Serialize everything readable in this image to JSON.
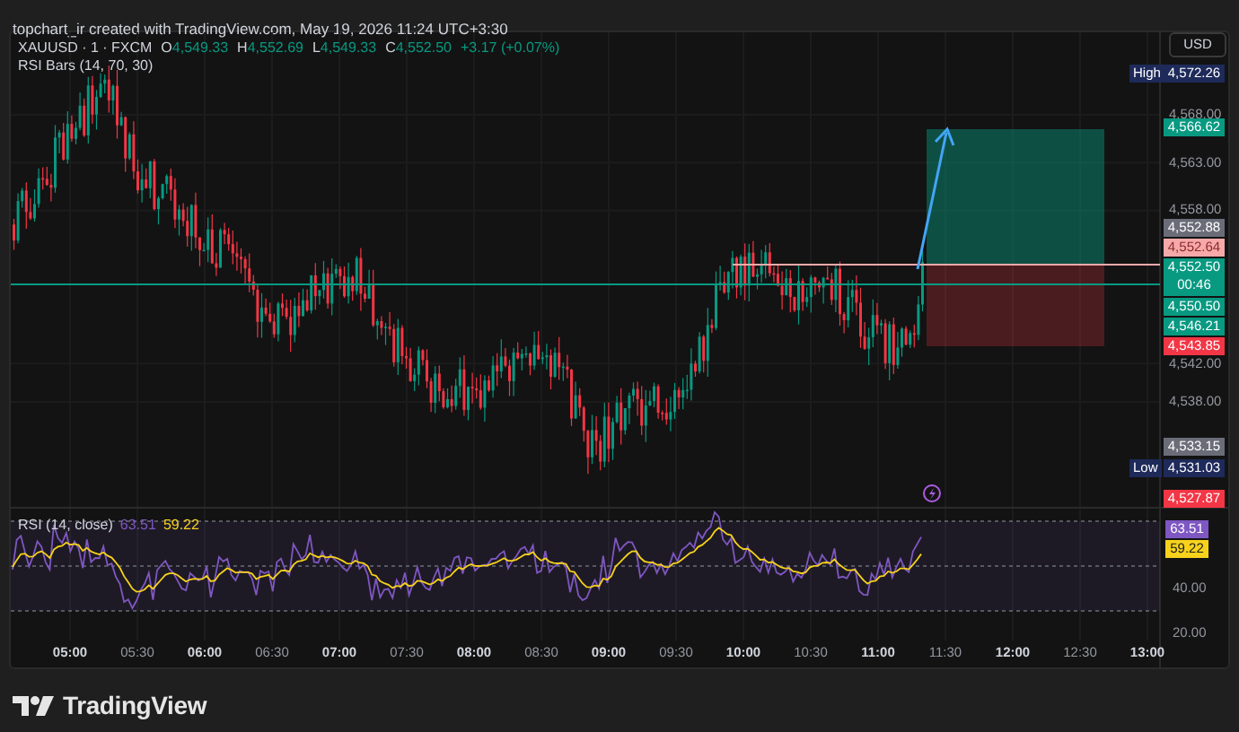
{
  "header": {
    "caption": "topchart_ir created with TradingView.com, May 19, 2026 11:24 UTC+3:30"
  },
  "legend": {
    "symbol": "XAUUSD · 1 · FXCM",
    "values": [
      {
        "label": "O",
        "value": "4,549.33"
      },
      {
        "label": "H",
        "value": "4,552.69"
      },
      {
        "label": "L",
        "value": "4,549.33"
      },
      {
        "label": "C",
        "value": "4,552.50"
      }
    ],
    "change": "+3.17 (+0.07%)",
    "indicator": "RSI Bars (14, 70, 30)"
  },
  "price_axis": {
    "currency": "USD",
    "ticks": [
      "4,568.00",
      "4,563.00",
      "4,558.00",
      "4,542.00",
      "4,538.00"
    ],
    "labels": [
      {
        "kind": "marker",
        "tag": "High",
        "text": "4,572.26"
      },
      {
        "kind": "price",
        "text": "4,566.62",
        "color": "#089981"
      },
      {
        "kind": "price",
        "text": "4,552.88",
        "color": "#6a6d78"
      },
      {
        "kind": "price",
        "text": "4,552.64",
        "color": "#f7a9a9"
      },
      {
        "kind": "countdown",
        "text": "4,552.50",
        "sub": "00:46",
        "color": "#089981"
      },
      {
        "kind": "price",
        "text": "4,550.50",
        "color": "#089981"
      },
      {
        "kind": "price",
        "text": "4,546.21",
        "color": "#089981"
      },
      {
        "kind": "price",
        "text": "4,543.85",
        "color": "#f23645"
      },
      {
        "kind": "price",
        "text": "4,533.15",
        "color": "#6a6d78"
      },
      {
        "kind": "marker",
        "tag": "Low",
        "text": "4,531.03"
      },
      {
        "kind": "price",
        "text": "4,527.87",
        "color": "#f23645"
      }
    ]
  },
  "rsi": {
    "title": "RSI (14, close)",
    "value": "63.51",
    "average": "59.22",
    "ticks": [
      "40.00",
      "20.00"
    ],
    "labels": [
      {
        "text": "63.51",
        "color": "#7e57c2"
      },
      {
        "text": "59.22",
        "color": "#f7d21c"
      }
    ]
  },
  "time_axis": [
    {
      "label": "05:00",
      "major": true
    },
    {
      "label": "05:30",
      "major": false
    },
    {
      "label": "06:00",
      "major": true
    },
    {
      "label": "06:30",
      "major": false
    },
    {
      "label": "07:00",
      "major": true
    },
    {
      "label": "07:30",
      "major": false
    },
    {
      "label": "08:00",
      "major": true
    },
    {
      "label": "08:30",
      "major": false
    },
    {
      "label": "09:00",
      "major": true
    },
    {
      "label": "09:30",
      "major": false
    },
    {
      "label": "10:00",
      "major": true
    },
    {
      "label": "10:30",
      "major": false
    },
    {
      "label": "11:00",
      "major": true
    },
    {
      "label": "11:30",
      "major": false
    },
    {
      "label": "12:00",
      "major": true
    },
    {
      "label": "12:30",
      "major": false
    },
    {
      "label": "13:00",
      "major": true
    }
  ],
  "footer": {
    "brand": "TradingView"
  }
}
